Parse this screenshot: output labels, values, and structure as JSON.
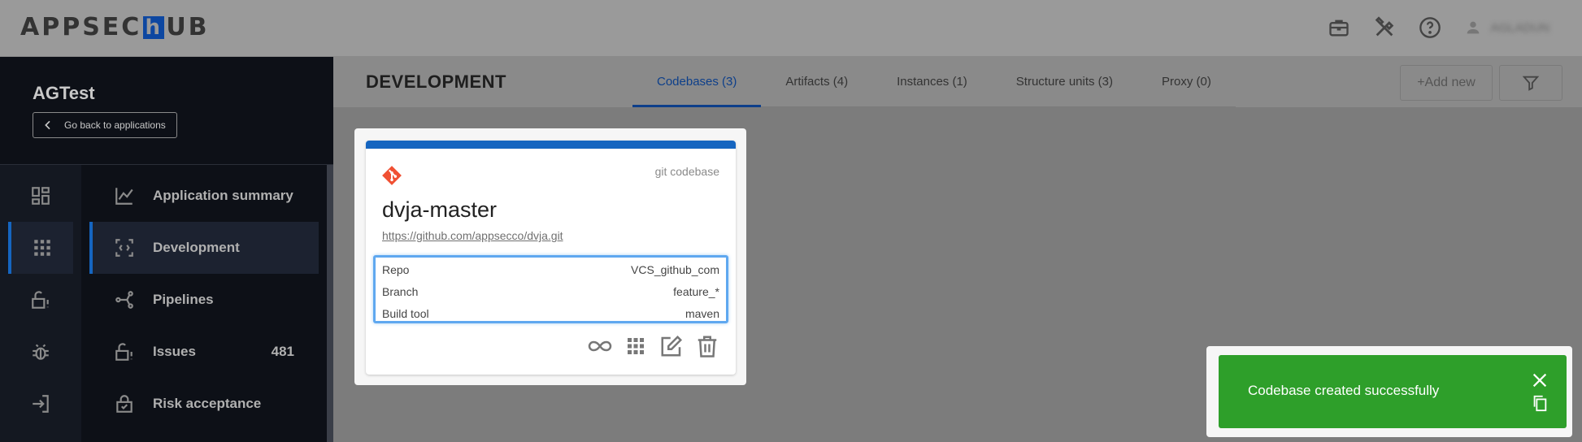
{
  "header": {
    "logo_prefix": "APPSEC",
    "logo_h": "h",
    "logo_suffix": "UB",
    "username": "AGLADUN"
  },
  "sidebar": {
    "app_title": "AGTest",
    "back_label": "Go back to applications",
    "items": [
      {
        "label": "Application summary",
        "count": ""
      },
      {
        "label": "Development",
        "count": ""
      },
      {
        "label": "Pipelines",
        "count": ""
      },
      {
        "label": "Issues",
        "count": "481"
      },
      {
        "label": "Risk acceptance",
        "count": ""
      }
    ]
  },
  "main": {
    "title": "DEVELOPMENT",
    "tabs": [
      {
        "label": "Codebases (3)",
        "active": true
      },
      {
        "label": "Artifacts (4)",
        "active": false
      },
      {
        "label": "Instances (1)",
        "active": false
      },
      {
        "label": "Structure units (3)",
        "active": false
      },
      {
        "label": "Proxy (0)",
        "active": false
      }
    ],
    "add_label": "+Add new"
  },
  "card": {
    "type": "git codebase",
    "name": "dvja-master",
    "url": "https://github.com/appsecco/dvja.git",
    "props": [
      {
        "key": "Repo",
        "value": "VCS_github_com"
      },
      {
        "key": "Branch",
        "value": "feature_*"
      },
      {
        "key": "Build tool",
        "value": "maven"
      }
    ]
  },
  "toast": {
    "message": "Codebase created successfully"
  },
  "colors": {
    "accent": "#1565c0",
    "toast": "#2e9f2a",
    "git": "#f05033",
    "highlight": "#5fa8f0"
  }
}
